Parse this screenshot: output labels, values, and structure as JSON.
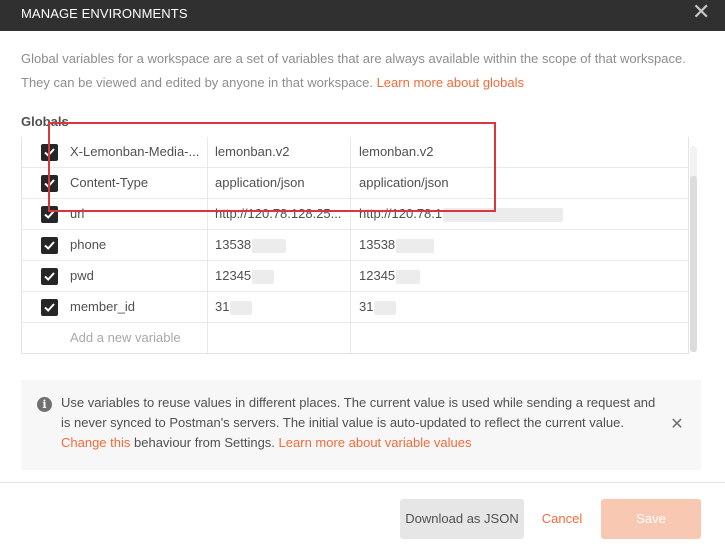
{
  "modal": {
    "title": "MANAGE ENVIRONMENTS",
    "close_glyph": "✕",
    "description": "Global variables for a workspace are a set of variables that are always available within the scope of that workspace. They can be viewed and edited by anyone in that workspace.",
    "learn_globals": "Learn more about globals"
  },
  "globals": {
    "label": "Globals",
    "rows": [
      {
        "key": "X-Lemonban-Media-...",
        "initial": "lemonban.v2",
        "current": "lemonban.v2",
        "enabled": true
      },
      {
        "key": "Content-Type",
        "initial": "application/json",
        "current": "application/json",
        "enabled": true
      },
      {
        "key": "url",
        "initial": "http://120.78.128.25...",
        "current": "http://120.78.1",
        "enabled": true
      },
      {
        "key": "phone",
        "initial": "13538",
        "current": "13538",
        "enabled": true
      },
      {
        "key": "pwd",
        "initial": "12345",
        "current": "12345",
        "enabled": true
      },
      {
        "key": "member_id",
        "initial": "31",
        "current": "31",
        "enabled": true
      }
    ],
    "add_placeholder": "Add a new variable"
  },
  "info": {
    "icon": "info-icon",
    "text": "Use variables to reuse values in different places. The current value is used while sending a request and is never synced to Postman's servers. The initial value is auto-updated to reflect the current value.",
    "change_link": "Change this",
    "text_after": "behaviour from Settings.",
    "learn_variables": "Learn more about variable values",
    "close_glyph": "✕"
  },
  "footer": {
    "download_label": "Download as JSON",
    "cancel_label": "Cancel",
    "save_label": "Save"
  },
  "colors": {
    "accent": "#f26b3a",
    "titlebar": "#303030",
    "highlight": "#d9363e"
  }
}
